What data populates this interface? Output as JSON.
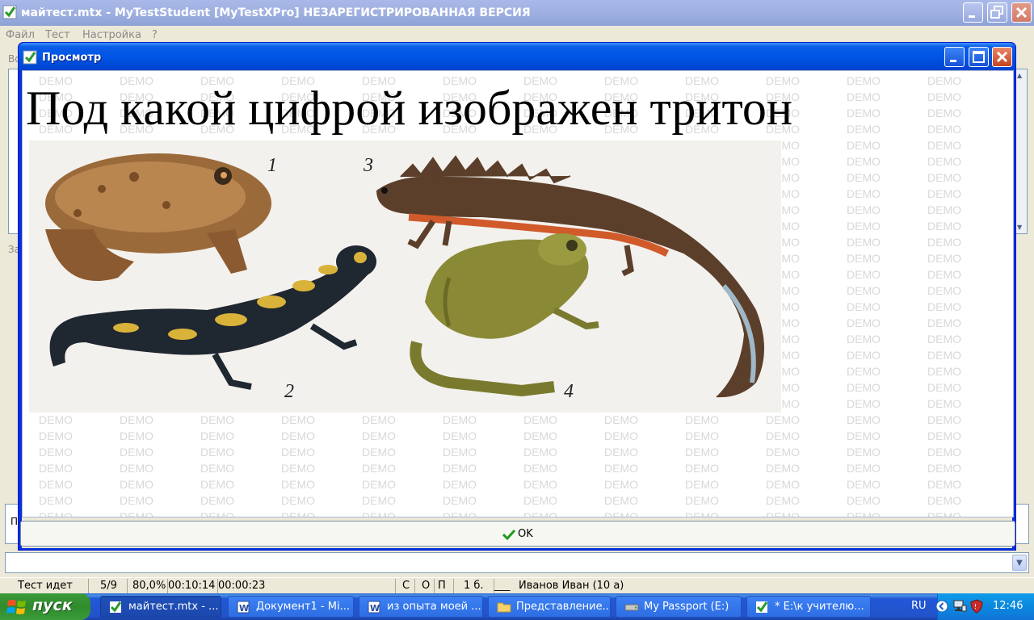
{
  "main_window": {
    "title": "майтест.mtx - MyTestStudent [MyTestXPro] НЕЗАРЕГИСТРИРОВАННАЯ ВЕРСИЯ",
    "menu": [
      "Файл",
      "Тест",
      "Настройка",
      "?"
    ],
    "side_labels": [
      "Во",
      "За",
      "П"
    ]
  },
  "status_bar": {
    "state": "Тест идет",
    "progress": "5/9",
    "percent": "80,0%",
    "time_elapsed": "00:10:14",
    "time_remaining": "00:00:23",
    "s": "С",
    "o": "О",
    "p": "П",
    "score": "1 б.",
    "blank": "___",
    "student": "Иванов Иван (10 а)"
  },
  "dialog": {
    "title": "Просмотр",
    "question": "Под какой цифрой изображен тритон",
    "watermark": "DEMO",
    "picture_numbers": [
      "1",
      "2",
      "3",
      "4"
    ],
    "ok_label": "OK"
  },
  "taskbar": {
    "start_label": "пуск",
    "tasks": [
      {
        "label": "майтест.mtx - ...",
        "icon": "checkbox-icon",
        "active": true
      },
      {
        "label": "Документ1 - Mi...",
        "icon": "word-icon",
        "active": false
      },
      {
        "label": "из опыта моей ...",
        "icon": "word-icon",
        "active": false
      },
      {
        "label": "Представление...",
        "icon": "folder-icon",
        "active": false
      },
      {
        "label": "My Passport (E:)",
        "icon": "drive-icon",
        "active": false
      },
      {
        "label": "* E:\\к учителю...",
        "icon": "checkbox-icon",
        "active": false
      }
    ],
    "language": "RU",
    "clock": "12:46"
  }
}
